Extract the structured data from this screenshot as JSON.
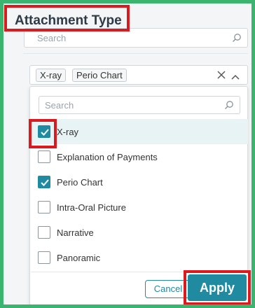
{
  "header": {
    "title": "Attachment Type"
  },
  "top_search": {
    "placeholder": "Search",
    "icon": "search-icon"
  },
  "select": {
    "chips": [
      "X-ray",
      "Perio Chart"
    ],
    "clear_icon": "close-icon",
    "collapse_icon": "chevron-up-icon"
  },
  "dropdown": {
    "search_placeholder": "Search",
    "options": [
      {
        "label": "X-ray",
        "checked": true
      },
      {
        "label": "Explanation of Payments",
        "checked": false
      },
      {
        "label": "Perio Chart",
        "checked": true
      },
      {
        "label": "Intra-Oral Picture",
        "checked": false
      },
      {
        "label": "Narrative",
        "checked": false
      },
      {
        "label": "Panoramic",
        "checked": false
      }
    ],
    "cancel_label": "Cancel",
    "apply_label": "Apply"
  },
  "colors": {
    "accent": "#1f8aa0",
    "highlight": "#d91a1f",
    "frame": "#3ab46f"
  }
}
